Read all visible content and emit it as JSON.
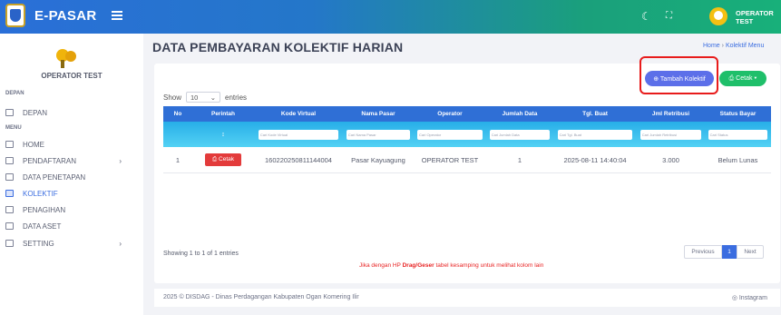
{
  "app": {
    "brand": "E-PASAR",
    "user": "OPERATOR TEST"
  },
  "sidebar": {
    "user": "OPERATOR TEST",
    "section_depan": "DEPAN",
    "section_menu": "MENU",
    "items": [
      {
        "label": "DEPAN",
        "icon": "home-icon"
      },
      {
        "label": "HOME",
        "icon": "home-icon"
      },
      {
        "label": "PENDAFTARAN",
        "icon": "form-icon"
      },
      {
        "label": "DATA PENETAPAN",
        "icon": "folder-icon"
      },
      {
        "label": "KOLEKTIF",
        "icon": "folder-icon"
      },
      {
        "label": "PENAGIHAN",
        "icon": "folder-icon"
      },
      {
        "label": "DATA ASET",
        "icon": "box-icon"
      },
      {
        "label": "SETTING",
        "icon": "gear-icon"
      }
    ]
  },
  "page": {
    "title": "DATA PEMBAYARAN KOLEKTIF HARIAN"
  },
  "breadcrumb": {
    "home": "Home",
    "sep": "›",
    "current": "Kolektif Menu"
  },
  "actions": {
    "tambah": "⊕ Tambah Kolektif",
    "cetak": "⎙ Cetak ▾"
  },
  "table": {
    "show_label": "Show",
    "show_value": "10",
    "entries_label": "entries",
    "headers": [
      "No",
      "Perintah",
      "Kode Virtual",
      "Nama Pasar",
      "Operator",
      "Jumlah Data",
      "Tgl. Buat",
      "Jml Retribusi",
      "Status Bayar"
    ],
    "filter_placeholders": [
      "Cari Kode Virtual",
      "Cari Nama Pasar",
      "Cari Operator",
      "Cari Jumlah Data",
      "Cari Tgl. Buat",
      "Cari Jumlah Retribusi",
      "Cari Status"
    ],
    "rows": [
      {
        "no": "1",
        "action": "⎙ Cetak",
        "kode": "160220250811144004",
        "pasar": "Pasar Kayuagung",
        "operator": "OPERATOR TEST",
        "jumlah": "1",
        "tgl": "2025-08-11 14:40:04",
        "retribusi": "3.000",
        "status": "Belum Lunas"
      }
    ],
    "info": "Showing 1 to 1 of 1 entries",
    "note_prefix": "Jika dengan HP",
    "note_bold": "Drag/Geser",
    "note_suffix": "tabel kesamping untuk melihat kolom lain"
  },
  "pagination": {
    "previous": "Previous",
    "current": "1",
    "next": "Next"
  },
  "footer": {
    "copyright": "2025 © DISDAG - Dinas Perdagangan Kabupaten Ogan Komering Ilir",
    "social": "◎ Instagram"
  }
}
